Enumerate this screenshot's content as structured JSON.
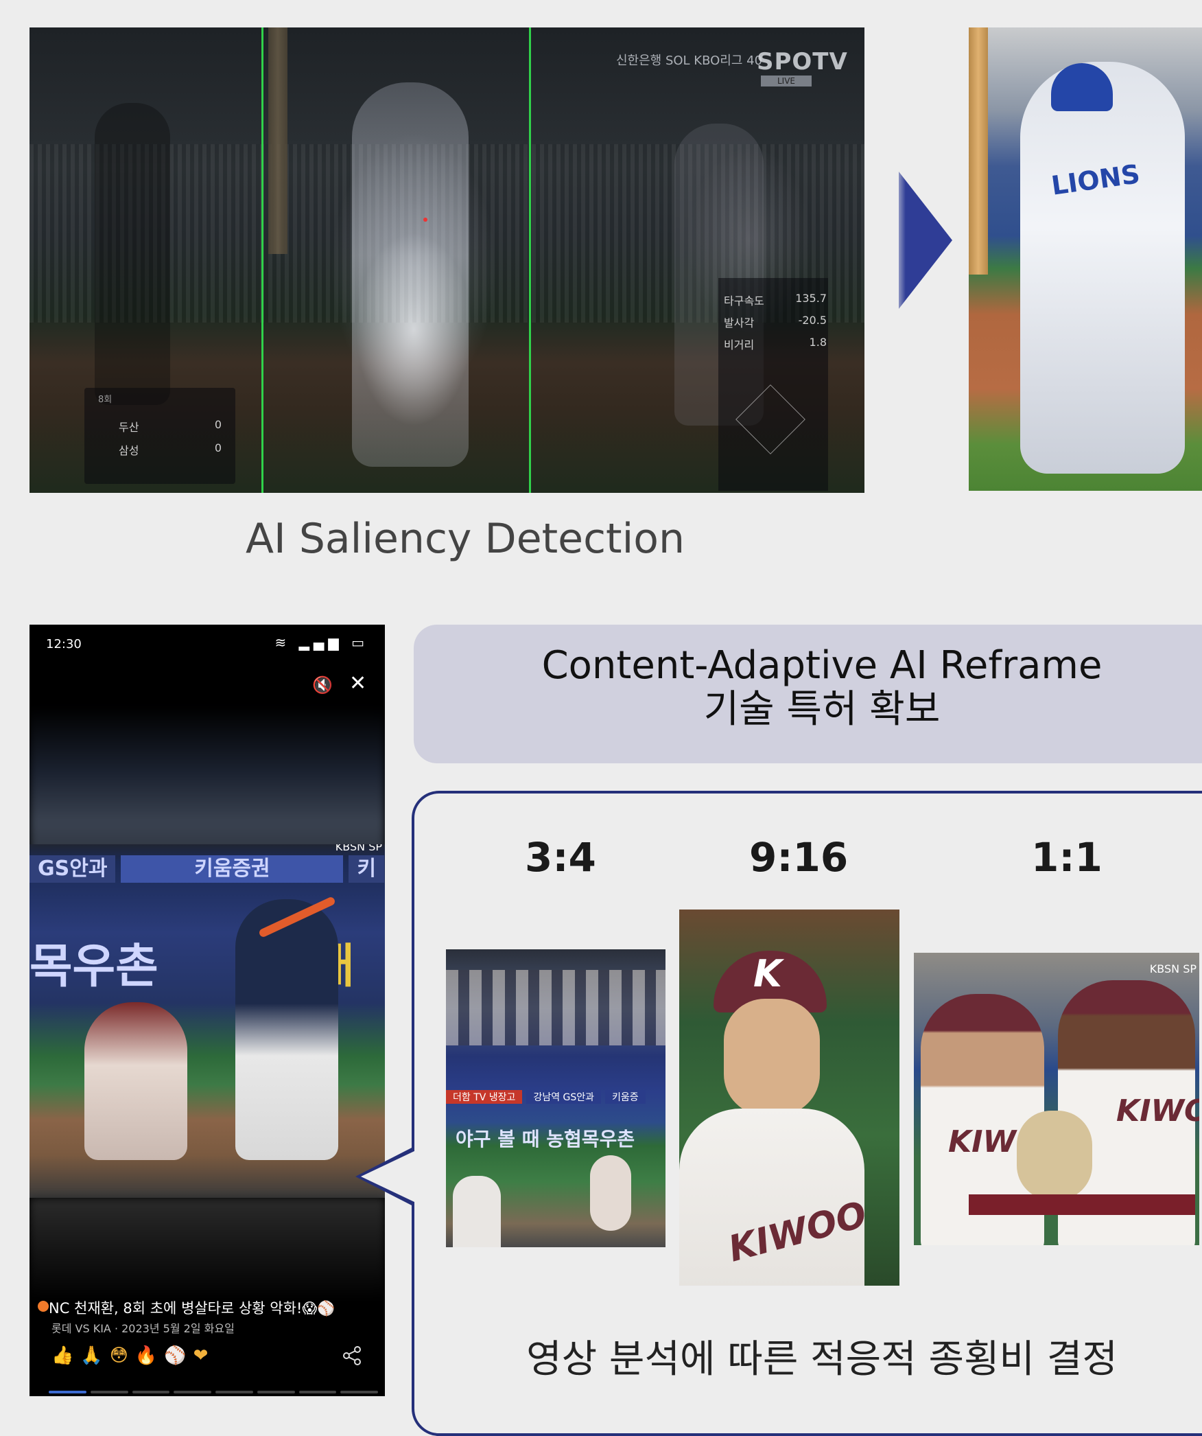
{
  "saliency": {
    "caption": "AI Saliency Detection",
    "broadcast_logo": "신한은행 SOL KBO리그 40",
    "channel": "SPOTV",
    "channel_sub": "LIVE",
    "scorebox": {
      "inning": "8회",
      "rows": [
        {
          "team": "두산",
          "score": "0"
        },
        {
          "team": "삼성",
          "score": "0"
        }
      ]
    },
    "stats": [
      {
        "label": "타구속도",
        "value": "135.7"
      },
      {
        "label": "발사각",
        "value": "-20.5"
      },
      {
        "label": "비거리",
        "value": "1.8"
      }
    ],
    "cropped_jersey": "LIONS"
  },
  "phone": {
    "time": "12:30",
    "status_icons": "≋ ▂▄▆ ▭",
    "mute_icon": "🔇",
    "close_icon": "✕",
    "ad_top": [
      "GS안과",
      "키움증권",
      "키"
    ],
    "ad_main": "목우촌",
    "ad_main_y": "래",
    "broadcaster": "KBSN SP",
    "headline": "NC 천재환, 8회 초에 병살타로 상황 악화!😱⚾",
    "subline": "롯데 VS KIA · 2023년 5월 2일 화요일",
    "reactions": "👍🙏😳🔥⚾❤",
    "share_icon": "share-icon"
  },
  "reframe": {
    "title_line1": "Content-Adaptive AI Reframe",
    "title_line2": "기술 특허 확보",
    "ratios": [
      "3:4",
      "9:16",
      "1:1"
    ],
    "thumb34": {
      "banner": [
        "더함 TV 냉장고",
        "강남역 GS안과",
        "키움증"
      ],
      "ad_text": "야구 볼 때 농협목우촌"
    },
    "thumb916": {
      "cap_letter": "K",
      "jersey": "KIWOO"
    },
    "thumb11": {
      "jersey1": "KIWO",
      "jersey2": "KIWOO",
      "broadcaster": "KBSN SP"
    },
    "caption": "영상 분석에 따른 적응적 종횡비 결정"
  },
  "colors": {
    "background": "#ededed",
    "accent": "#25307a",
    "saliency_guide": "#30d14a",
    "panel": "#d0d0de"
  }
}
